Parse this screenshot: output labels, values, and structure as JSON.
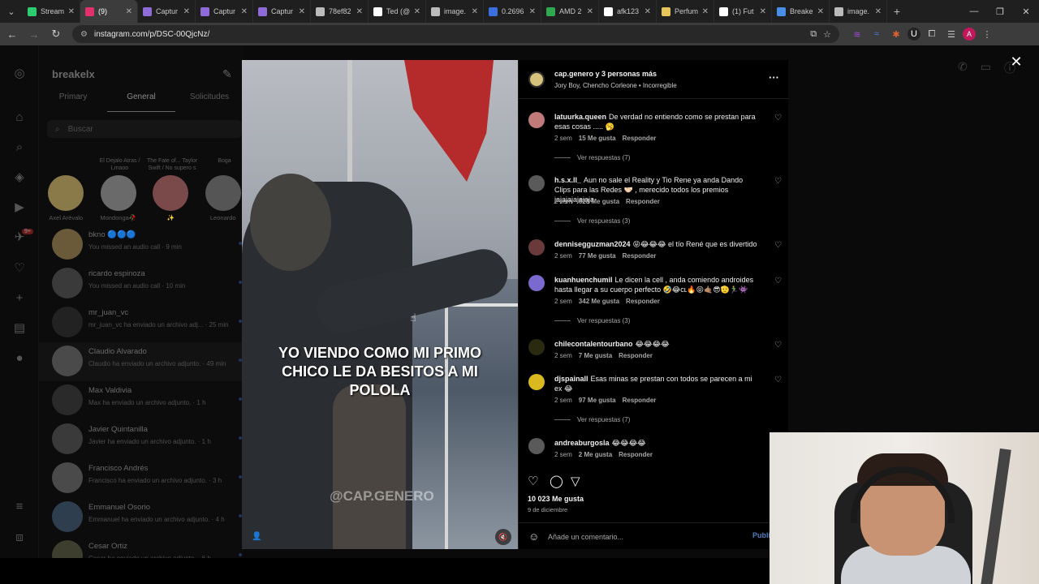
{
  "browser": {
    "tabs": [
      {
        "label": "Stream",
        "color": "#2ecc71",
        "active": false
      },
      {
        "label": "(9)",
        "color": "#e1306c",
        "active": true
      },
      {
        "label": "Captur",
        "color": "#8e6bd6",
        "active": false
      },
      {
        "label": "Captur",
        "color": "#8e6bd6",
        "active": false
      },
      {
        "label": "Captur",
        "color": "#8e6bd6",
        "active": false
      },
      {
        "label": "78ef82",
        "color": "#bbbbbb",
        "active": false
      },
      {
        "label": "Ted (@",
        "color": "#ffffff",
        "active": false
      },
      {
        "label": "image.",
        "color": "#bbbbbb",
        "active": false
      },
      {
        "label": "0.2696",
        "color": "#3b6fe0",
        "active": false
      },
      {
        "label": "AMD 2",
        "color": "#2fa84f",
        "active": false
      },
      {
        "label": "afk123",
        "color": "#ffffff",
        "active": false
      },
      {
        "label": "Perfum",
        "color": "#e6c45a",
        "active": false
      },
      {
        "label": "(1) Fut",
        "color": "#ffffff",
        "active": false
      },
      {
        "label": "Breake",
        "color": "#4a8fe7",
        "active": false
      },
      {
        "label": "image.",
        "color": "#bbbbbb",
        "active": false
      }
    ],
    "url": "instagram.com/p/DSC-00QjcNz/",
    "profile_initial": "A"
  },
  "dm": {
    "username": "breakelx",
    "tabs": [
      "Primary",
      "General",
      "Solicitudes"
    ],
    "search_placeholder": "Buscar",
    "notes": [
      {
        "bubble": "",
        "name": "Axel Arévalo",
        "color": "#8a7a4a"
      },
      {
        "bubble": "El Dejalo Atras / Lmaoo",
        "name": "Mondonga🥀",
        "color": "#6a6a6a"
      },
      {
        "bubble": "The Fate of... Taylor Swift / No supero s",
        "name": "✨",
        "color": "#7a4a4a"
      },
      {
        "bubble": "Boga",
        "name": "Leonardo",
        "color": "#555"
      }
    ],
    "badge": "9+",
    "conversations": [
      {
        "name": "bkno 🔵🔵🔵",
        "sub": "You missed an audio call · 9 min",
        "color": "#6a5a3a"
      },
      {
        "name": "ricardo espinoza",
        "sub": "You missed an audio call · 10 min",
        "color": "#3a3a3a"
      },
      {
        "name": "mr_juan_vc",
        "sub": "mr_juan_vc ha enviado un archivo adj... · 25 min",
        "color": "#222"
      },
      {
        "name": "Claudio Alvarado",
        "sub": "Claudio ha enviado un archivo adjunto. · 49 min",
        "color": "#4a4a4a"
      },
      {
        "name": "Max Valdivia",
        "sub": "Max ha enviado un archivo adjunto. · 1 h",
        "color": "#2a2a2a"
      },
      {
        "name": "Javier Quintanilla",
        "sub": "Javier ha enviado un archivo adjunto. · 1 h",
        "color": "#3a3a3a"
      },
      {
        "name": "Francisco Andrés",
        "sub": "Francisco ha enviado un archivo adjunto. · 3 h",
        "color": "#4a4a4a"
      },
      {
        "name": "Emmanuel Osorio",
        "sub": "Emmanuel ha enviado un archivo adjunto. · 4 h",
        "color": "#2e3e4e"
      },
      {
        "name": "Cesar Ortiz",
        "sub": "Cesar ha enviado un archivo adjunto. · 6 h",
        "color": "#3e3e2e"
      }
    ]
  },
  "video": {
    "caption": "YO VIENDO COMO MI PRIMO CHICO LE DA BESITOS A MI POLOLA",
    "watermark": "@CAP.GENERO"
  },
  "post": {
    "header_user": "cap.genero y 3 personas más",
    "header_song": "Jory Boy, Chencho Corleone • Incorregible",
    "comments": [
      {
        "user": "latuurka.queen",
        "text": "De verdad no entiendo como se prestan para esas cosas ..... 🥱",
        "time": "2 sem",
        "likes": "15 Me gusta",
        "reply": "Responder",
        "replies": "Ver respuestas (7)",
        "color": "#c07a7a"
      },
      {
        "user": "h.s.x.ll_",
        "text": "Aun no sale el Reality y Tio Rene ya anda Dando Clips para las Redes 🤝🏻 , merecido todos los premios jajajajajajaja",
        "time": "2 sem",
        "likes": "628 Me gusta",
        "reply": "Responder",
        "replies": "Ver respuestas (3)",
        "color": "#5a5a5a"
      },
      {
        "user": "dennisegguzman2024",
        "text": "😝😂😂😂 el tío René que es divertido",
        "time": "2 sem",
        "likes": "77 Me gusta",
        "reply": "Responder",
        "replies": "",
        "color": "#6a3a3a"
      },
      {
        "user": "kuanhuenchumil",
        "text": "Le dicen la cell , anda comiendo androides hasta llegar a su cuerpo perfecto 🤣😂cʟ🔥😝🤙🏽😎🫡🏃‍♂️👾",
        "time": "2 sem",
        "likes": "342 Me gusta",
        "reply": "Responder",
        "replies": "Ver respuestas (3)",
        "color": "#7a6ad0"
      },
      {
        "user": "chilecontalentourbano",
        "text": "😂😂😂😂",
        "time": "2 sem",
        "likes": "7 Me gusta",
        "reply": "Responder",
        "replies": "",
        "color": "#2a2a10"
      },
      {
        "user": "djspainall",
        "text": "Esas minas se prestan con todos se parecen a mi ex 😂",
        "time": "2 sem",
        "likes": "97 Me gusta",
        "reply": "Responder",
        "replies": "Ver respuestas (7)",
        "color": "#d9b820"
      },
      {
        "user": "andreaburgosla",
        "text": "😂😂😂😂",
        "time": "2 sem",
        "likes": "2 Me gusta",
        "reply": "Responder",
        "replies": "",
        "color": "#5a5a5a"
      }
    ],
    "total_likes": "10 023 Me gusta",
    "date": "9 de diciembre",
    "comment_placeholder": "Añade un comentario...",
    "publish_label": "Publi"
  }
}
